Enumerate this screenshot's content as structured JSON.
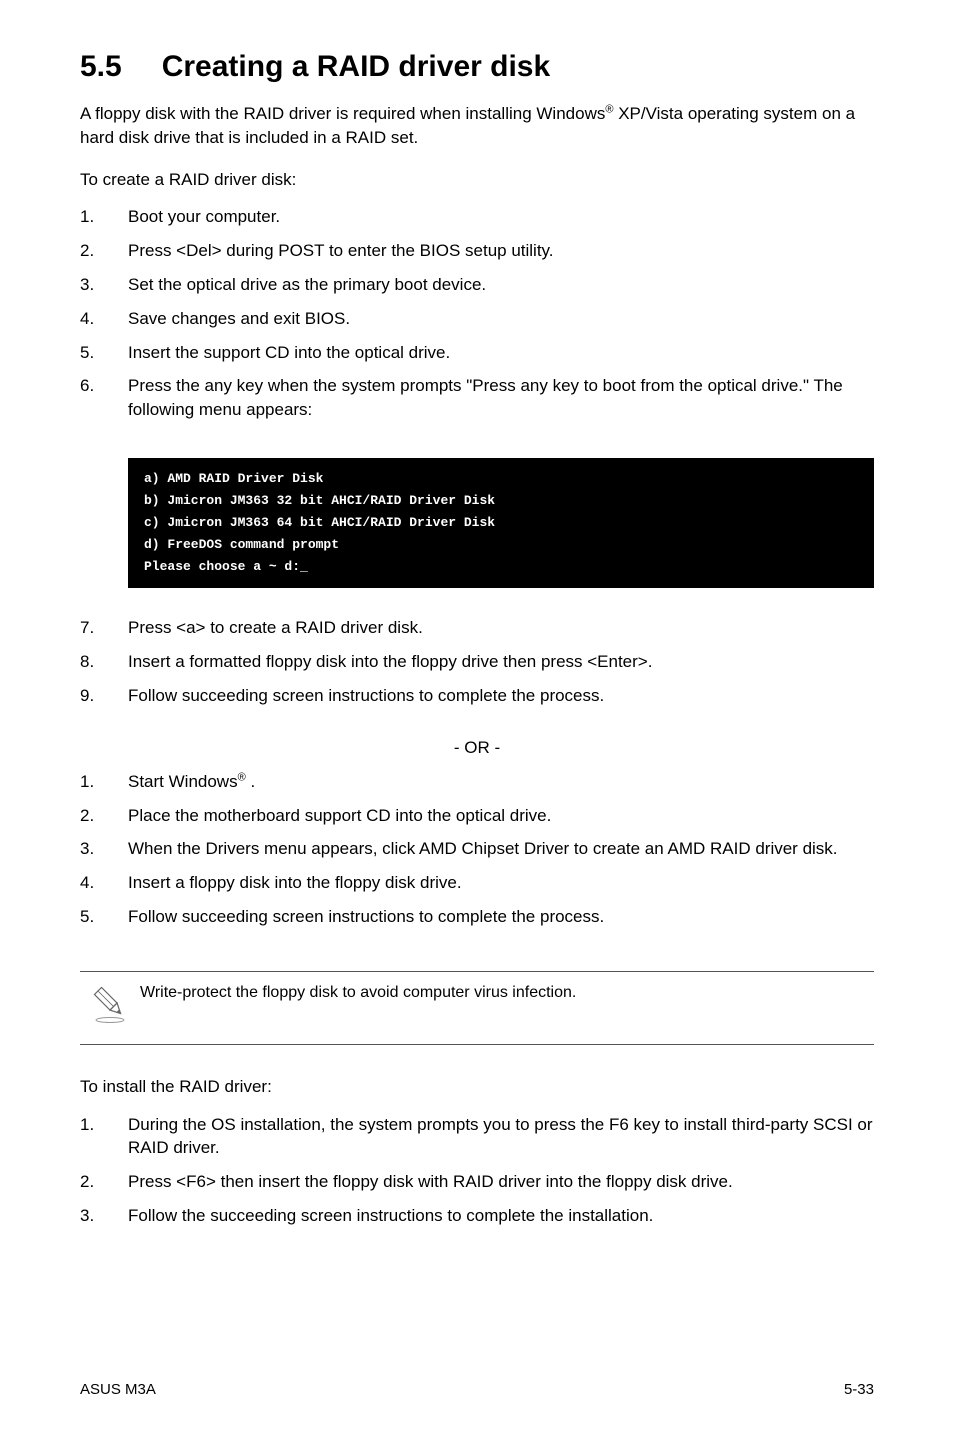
{
  "heading": {
    "number": "5.5",
    "title": "Creating a RAID driver disk"
  },
  "intro": {
    "prefix": "A floppy disk with the RAID driver is required when installing Windows",
    "sup": "®",
    "suffix": " XP/Vista operating system on a hard disk drive that is included in a RAID set."
  },
  "section1_label": "To create a RAID driver disk:",
  "list1": [
    {
      "num": "1.",
      "text": "Boot your computer."
    },
    {
      "num": "2.",
      "text": "Press <Del> during POST to enter the BIOS setup utility."
    },
    {
      "num": "3.",
      "text": "Set the optical drive as the primary boot device."
    },
    {
      "num": "4.",
      "text": "Save changes and exit BIOS."
    },
    {
      "num": "5.",
      "text": "Insert the support CD into the optical drive."
    },
    {
      "num": "6.",
      "text": "Press the any key when the system prompts \"Press any key to boot from the optical drive.\" The following menu appears:"
    }
  ],
  "code_lines": [
    "a) AMD RAID Driver Disk",
    "b) Jmicron JM363 32 bit AHCI/RAID Driver Disk",
    "c) Jmicron JM363 64 bit AHCI/RAID Driver Disk",
    "d) FreeDOS command prompt",
    "Please choose a ~ d:_"
  ],
  "list2": [
    {
      "num": "7.",
      "text": "Press <a> to create a RAID driver disk."
    },
    {
      "num": "8.",
      "text": "Insert a formatted floppy disk into the floppy drive then press <Enter>."
    },
    {
      "num": "9.",
      "text": "Follow succeeding screen instructions to complete the process."
    }
  ],
  "or_text": "- OR -",
  "list3": [
    {
      "num": "1.",
      "prefix": "Start Windows",
      "sup": "®",
      "suffix": " ."
    },
    {
      "num": "2.",
      "text": "Place the motherboard support CD into the optical drive."
    },
    {
      "num": "3.",
      "text": "When the Drivers menu appears, click AMD Chipset Driver to create an AMD RAID driver disk."
    },
    {
      "num": "4.",
      "text": "Insert a floppy disk into the floppy disk drive."
    },
    {
      "num": "5.",
      "text": "Follow succeeding screen instructions to complete the process."
    }
  ],
  "note_text": "Write-protect the floppy disk to avoid computer virus infection.",
  "section2_label": "To install the RAID driver:",
  "list4": [
    {
      "num": "1.",
      "text": "During the OS installation, the system prompts you to press the F6 key to install third-party SCSI or RAID driver."
    },
    {
      "num": "2.",
      "text": "Press <F6> then insert the floppy disk with RAID driver into the floppy disk drive."
    },
    {
      "num": "3.",
      "text": "Follow the succeeding screen instructions to complete the installation."
    }
  ],
  "footer": {
    "left": "ASUS M3A",
    "right": "5-33"
  }
}
